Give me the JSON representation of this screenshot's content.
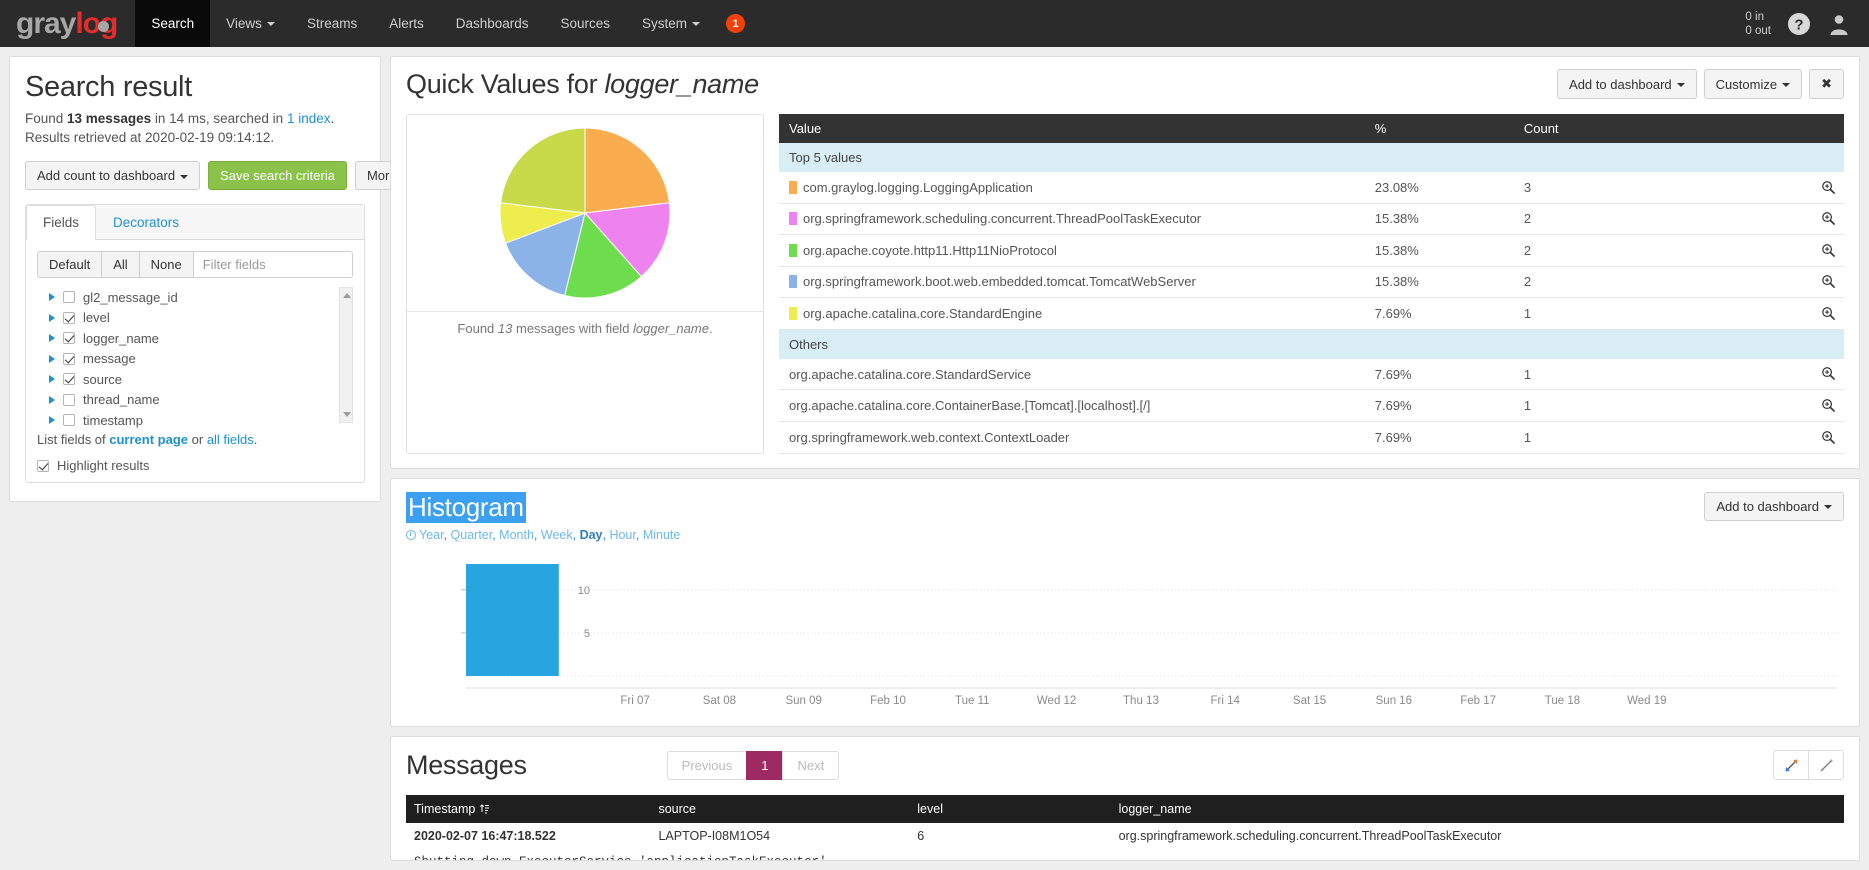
{
  "navbar": {
    "brand": {
      "part1": "gray",
      "part2": "log"
    },
    "items": [
      {
        "label": "Search",
        "active": true,
        "caret": false
      },
      {
        "label": "Views",
        "active": false,
        "caret": true
      },
      {
        "label": "Streams",
        "active": false,
        "caret": false
      },
      {
        "label": "Alerts",
        "active": false,
        "caret": false
      },
      {
        "label": "Dashboards",
        "active": false,
        "caret": false
      },
      {
        "label": "Sources",
        "active": false,
        "caret": false
      },
      {
        "label": "System",
        "active": false,
        "caret": true
      }
    ],
    "badge": "1",
    "throughput_in": "0 in",
    "throughput_out": "0 out",
    "help_icon": "help-circle-icon",
    "user_icon": "user-avatar-icon"
  },
  "search_result": {
    "title": "Search result",
    "found_prefix": "Found ",
    "found_messages": "13 messages",
    "found_mid": " in 14 ms, searched in ",
    "found_index": "1 index",
    "found_suffix": ".",
    "retrieved": "Results retrieved at 2020-02-19 09:14:12.",
    "buttons": {
      "add_count": "Add count to dashboard",
      "save_criteria": "Save search criteria",
      "more_actions": "More actions"
    }
  },
  "fields": {
    "tabs": [
      {
        "label": "Fields",
        "active": true
      },
      {
        "label": "Decorators",
        "active": false
      }
    ],
    "segments": [
      "Default",
      "All",
      "None"
    ],
    "filter_placeholder": "Filter fields",
    "filter_value": "",
    "items": [
      {
        "label": "gl2_message_id",
        "checked": false
      },
      {
        "label": "level",
        "checked": true
      },
      {
        "label": "logger_name",
        "checked": true
      },
      {
        "label": "message",
        "checked": true
      },
      {
        "label": "source",
        "checked": true
      },
      {
        "label": "thread_name",
        "checked": false
      },
      {
        "label": "timestamp",
        "checked": false
      }
    ],
    "list_fields_prefix": "List fields of ",
    "list_fields_current": "current page",
    "list_fields_mid": " or ",
    "list_fields_all": "all fields",
    "list_fields_suffix": ".",
    "highlight_label": "Highlight results",
    "highlight_checked": true
  },
  "quick_values": {
    "title_prefix": "Quick Values for ",
    "title_field": "logger_name",
    "actions": {
      "add_to_dashboard": "Add to dashboard",
      "customize": "Customize",
      "close": "✖"
    },
    "caption_prefix": "Found ",
    "caption_count": "13",
    "caption_suffix": " messages with field ",
    "caption_field": "logger_name",
    "caption_end": ".",
    "columns": [
      "Value",
      "%",
      "Count"
    ],
    "group_top": "Top 5 values",
    "group_others": "Others",
    "top_rows": [
      {
        "value": "com.graylog.logging.LoggingApplication",
        "pct": "23.08%",
        "count": "3",
        "color": "#f9ad4e"
      },
      {
        "value": "org.springframework.scheduling.concurrent.ThreadPoolTaskExecutor",
        "pct": "15.38%",
        "count": "2",
        "color": "#ee82ee"
      },
      {
        "value": "org.apache.coyote.http11.Http11NioProtocol",
        "pct": "15.38%",
        "count": "2",
        "color": "#6ddd4e"
      },
      {
        "value": "org.springframework.boot.web.embedded.tomcat.TomcatWebServer",
        "pct": "15.38%",
        "count": "2",
        "color": "#8cb3e8"
      },
      {
        "value": "org.apache.catalina.core.StandardEngine",
        "pct": "7.69%",
        "count": "1",
        "color": "#eded4e"
      }
    ],
    "other_rows": [
      {
        "value": "org.apache.catalina.core.StandardService",
        "pct": "7.69%",
        "count": "1"
      },
      {
        "value": "org.apache.catalina.core.ContainerBase.[Tomcat].[localhost].[/]",
        "pct": "7.69%",
        "count": "1"
      },
      {
        "value": "org.springframework.web.context.ContextLoader",
        "pct": "7.69%",
        "count": "1"
      }
    ]
  },
  "histogram": {
    "title": "Histogram",
    "intervals": [
      {
        "label": "Year",
        "selected": false
      },
      {
        "label": "Quarter",
        "selected": false
      },
      {
        "label": "Month",
        "selected": false
      },
      {
        "label": "Week",
        "selected": false
      },
      {
        "label": "Day",
        "selected": true
      },
      {
        "label": "Hour",
        "selected": false
      },
      {
        "label": "Minute",
        "selected": false
      }
    ],
    "add_to_dashboard": "Add to dashboard"
  },
  "messages": {
    "title": "Messages",
    "pager": {
      "previous": "Previous",
      "current": "1",
      "next": "Next"
    },
    "expand_icon": "expand-all-icon",
    "collapse_icon": "collapse-all-icon",
    "columns": [
      "Timestamp",
      "source",
      "level",
      "logger_name"
    ],
    "rows": [
      {
        "timestamp": "2020-02-07 16:47:18.522",
        "source": "LAPTOP-I08M1O54",
        "level": "6",
        "logger_name": "org.springframework.scheduling.concurrent.ThreadPoolTaskExecutor",
        "body": "Shutting down ExecutorService 'applicationTaskExecutor'"
      }
    ]
  },
  "chart_data": [
    {
      "type": "pie",
      "title": "Quick Values for logger_name",
      "labels": [
        "com.graylog.logging.LoggingApplication",
        "org.springframework.scheduling.concurrent.ThreadPoolTaskExecutor",
        "org.apache.coyote.http11.Http11NioProtocol",
        "org.springframework.boot.web.embedded.tomcat.TomcatWebServer",
        "org.apache.catalina.core.StandardEngine",
        "Others"
      ],
      "values": [
        23.08,
        15.38,
        15.38,
        15.38,
        7.69,
        23.08
      ],
      "counts": [
        3,
        2,
        2,
        2,
        1,
        3
      ],
      "colors": [
        "#f9ad4e",
        "#ee82ee",
        "#6ddd4e",
        "#8cb3e8",
        "#eded4e",
        "#c8d94a"
      ],
      "legend": "none",
      "start_angle_deg": -90
    },
    {
      "type": "bar",
      "title": "Histogram",
      "interval": "Day",
      "categories": [
        "Fri 07",
        "Sat 08",
        "Sun 09",
        "Feb 10",
        "Tue 11",
        "Wed 12",
        "Thu 13",
        "Fri 14",
        "Sat 15",
        "Sun 16",
        "Feb 17",
        "Tue 18",
        "Wed 19"
      ],
      "values": [
        13,
        0,
        0,
        0,
        0,
        0,
        0,
        0,
        0,
        0,
        0,
        0,
        0
      ],
      "ytick_labels": [
        "5",
        "10"
      ],
      "yticks": [
        5,
        10
      ],
      "ylim": [
        0,
        13
      ],
      "xlabel": "",
      "ylabel": "",
      "grid": true,
      "bar_color": "#26a5e0"
    }
  ]
}
